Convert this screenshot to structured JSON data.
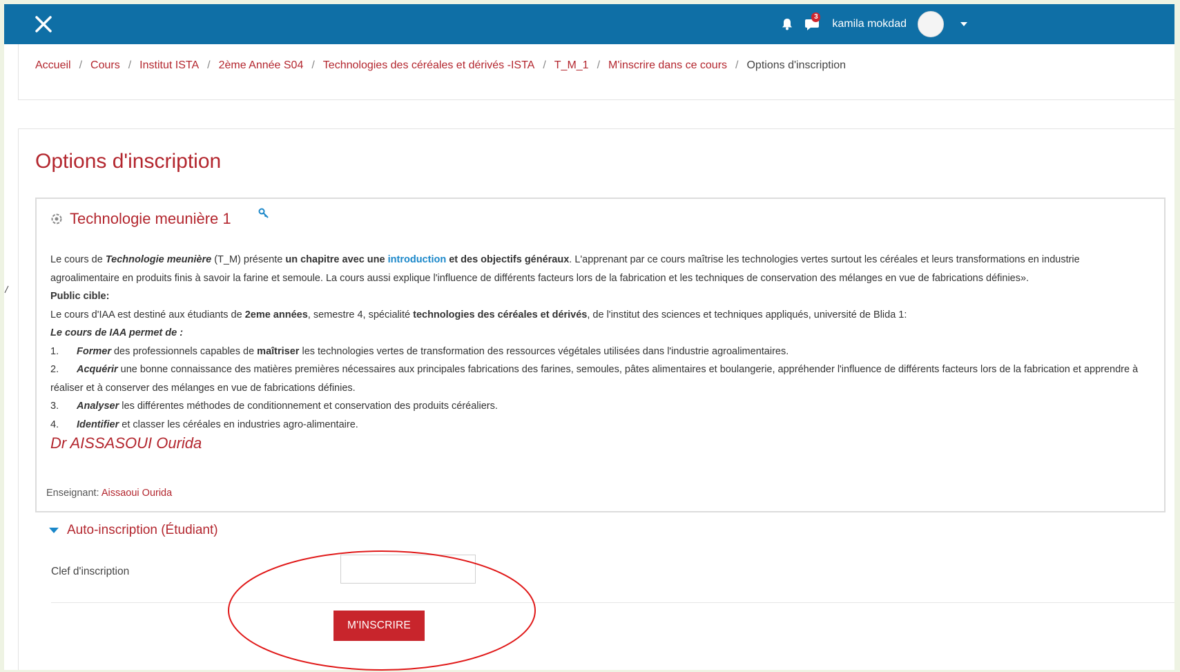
{
  "navbar": {
    "close_icon": "close-icon",
    "notification_icon": "bell-icon",
    "messages_icon": "chat-icon",
    "messages_count": "3",
    "username": "kamila mokdad",
    "accent": "#0f6fa6"
  },
  "breadcrumb": {
    "items": [
      "Accueil",
      "Cours",
      "Institut ISTA",
      "2ème Année S04",
      "Technologies des céréales et dérivés -ISTA",
      "T_M_1",
      "M'inscrire dans ce cours"
    ],
    "current": "Options d'inscription",
    "separator": "/"
  },
  "page": {
    "title": "Options d'inscription",
    "brand_color": "#b3262e"
  },
  "course": {
    "name": "Technologie meunière 1",
    "summary": {
      "p1_a": "Le cours de ",
      "p1_b": "Technologie meunière",
      "p1_c": " (T_M) présente ",
      "p1_d": "un chapitre avec une ",
      "p1_e": "introduction",
      "p1_f": " et des objectifs généraux",
      "p1_g": ". L'apprenant par ce cours maîtrise les technologies vertes surtout les céréales et leurs transformations en industrie agroalimentaire en produits finis à savoir la farine et semoule.  La cours aussi explique l'influence de différents facteurs lors de la fabrication et les techniques de  conservation des mélanges en vue de fabrications définies».",
      "public_heading": "Public cible:",
      "p2_a": "Le cours d'IAA est destiné aux étudiants de ",
      "p2_b": "2eme années",
      "p2_c": ", semestre 4, spécialité ",
      "p2_d": "technologies des céréales et dérivés",
      "p2_e": ", de l'institut des sciences et techniques appliqués, université de Blida 1:",
      "goals_heading": "Le cours de IAA permet de :",
      "goals": [
        {
          "num": "1.",
          "verb": "Former",
          "pre": " des professionnels capables de ",
          "bold": "maîtriser",
          "rest": " les technologies vertes de transformation des ressources végétales utilisées dans l'industrie agroalimentaires."
        },
        {
          "num": "2.",
          "verb": "Acquérir",
          "pre": " une bonne connaissance des matières premières nécessaires aux principales fabrications des farines, semoules, pâtes alimentaires et boulangerie, appréhender l'influence de différents facteurs lors de la fabrication et apprendre à réaliser et à conserver des mélanges en vue de fabrications définies.",
          "bold": "",
          "rest": ""
        },
        {
          "num": "3.",
          "verb": "Analyser",
          "pre": " les différentes méthodes de conditionnement et conservation des produits céréaliers.",
          "bold": "",
          "rest": ""
        },
        {
          "num": "4.",
          "verb": "Identifier",
          "pre": " et classer les céréales en industries agro-alimentaire.",
          "bold": "",
          "rest": ""
        }
      ],
      "signature": "Dr AISSASOUI Ourida"
    },
    "teacher_label": "Enseignant:",
    "teacher_name": "Aissaoui Ourida"
  },
  "enrolment": {
    "section_title": "Auto-inscription (Étudiant)",
    "key_label": "Clef d'inscription",
    "key_value": "",
    "submit_label": "M'INSCRIRE",
    "button_color": "#c8252c",
    "highlight_color": "#e01818"
  }
}
